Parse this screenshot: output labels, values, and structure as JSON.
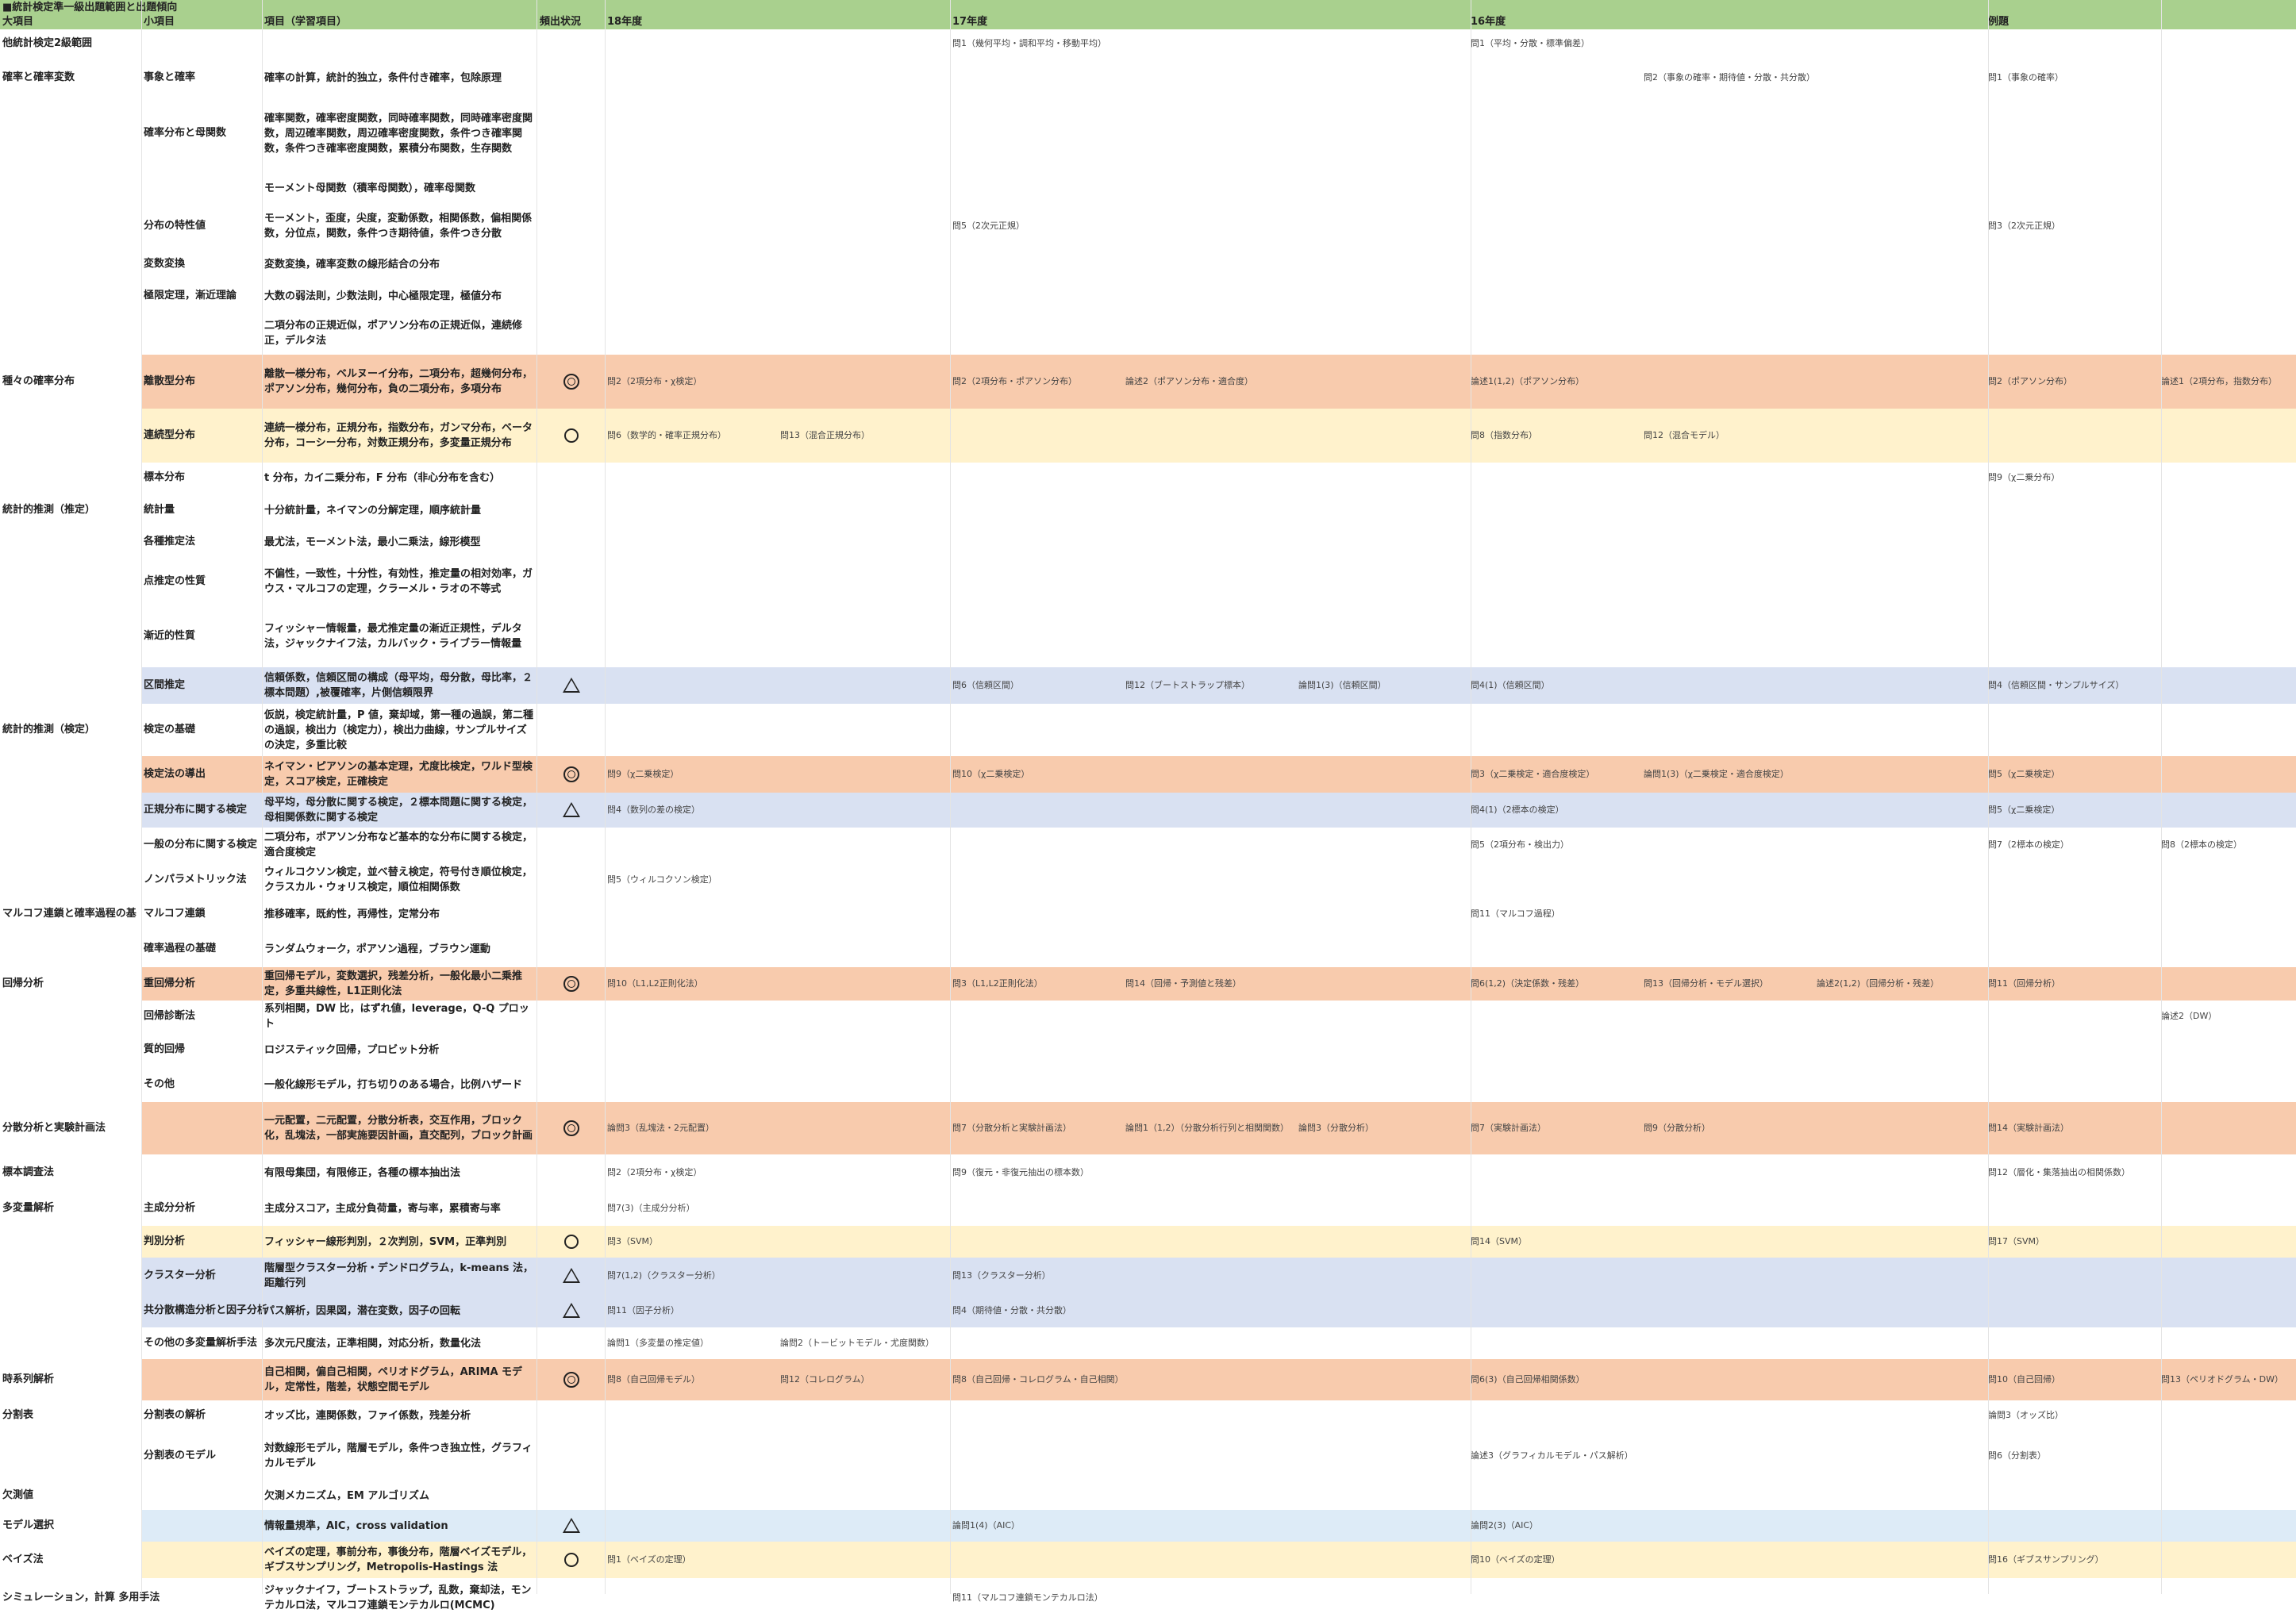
{
  "header": {
    "title": "■統計検定準一級出題範囲と出題傾向",
    "col_major": "大項目",
    "col_minor": "小項目",
    "col_item": "項目（学習項目）",
    "col_freq": "頻出状況",
    "col_y18": "18年度",
    "col_y17": "17年度",
    "col_y16": "16年度",
    "col_ex": "例題"
  },
  "colors": {
    "header": "#a9d08e",
    "orange": "#f8cbad",
    "yellow": "#fff2cc",
    "blue": "#d9e1f2",
    "lightblue": "#ddebf7"
  },
  "rows": [
    {
      "major": "他統計検定2級範囲",
      "minor": "",
      "item": "",
      "freq": "",
      "y18": [
        "",
        ""
      ],
      "y17": [
        "問1（幾何平均・調和平均・移動平均）",
        "",
        ""
      ],
      "y16": [
        "問1（平均・分散・標準偏差）",
        "",
        ""
      ],
      "ex": [
        "",
        ""
      ]
    },
    {
      "major": "確率と確率変数",
      "minor": "事象と確率",
      "item": "確率の計算，統計的独立，条件付き確率，包除原理",
      "freq": "",
      "y18": [
        "",
        ""
      ],
      "y17": [
        "",
        "",
        ""
      ],
      "y16": [
        "",
        "問2（事象の確率・期待値・分散・共分散）",
        ""
      ],
      "ex": [
        "問1（事象の確率）",
        ""
      ]
    },
    {
      "major": "",
      "minor": "確率分布と母関数",
      "item": "確率関数，確率密度関数，同時確率関数，同時確率密度関数，周辺確率関数，周辺確率密度関数，条件つき確率関数，条件つき確率密度関数，累積分布関数，生存関数",
      "freq": "",
      "y18": [
        "",
        ""
      ],
      "y17": [
        "",
        "",
        ""
      ],
      "y16": [
        "",
        "",
        ""
      ],
      "ex": [
        "",
        ""
      ]
    },
    {
      "major": "",
      "minor": "",
      "item": "モーメント母関数（積率母関数），確率母関数",
      "freq": "",
      "y18": [
        "",
        ""
      ],
      "y17": [
        "",
        "",
        ""
      ],
      "y16": [
        "",
        "",
        ""
      ],
      "ex": [
        "",
        ""
      ]
    },
    {
      "major": "",
      "minor": "分布の特性値",
      "item": "モーメント，歪度，尖度，変動係数，相関係数，偏相関係数，分位点，関数，条件つき期待値，条件つき分散",
      "freq": "",
      "y18": [
        "",
        ""
      ],
      "y17": [
        "問5（2次元正規）",
        "",
        ""
      ],
      "y16": [
        "",
        "",
        ""
      ],
      "ex": [
        "問3（2次元正規）",
        ""
      ]
    },
    {
      "major": "",
      "minor": "変数変換",
      "item": "変数変換，確率変数の線形結合の分布",
      "freq": "",
      "y18": [
        "",
        ""
      ],
      "y17": [
        "",
        "",
        ""
      ],
      "y16": [
        "",
        "",
        ""
      ],
      "ex": [
        "",
        ""
      ]
    },
    {
      "major": "",
      "minor": "極限定理，漸近理論",
      "item": "大数の弱法則，少数法則，中心極限定理，極値分布",
      "freq": "",
      "y18": [
        "",
        ""
      ],
      "y17": [
        "",
        "",
        ""
      ],
      "y16": [
        "",
        "",
        ""
      ],
      "ex": [
        "",
        ""
      ]
    },
    {
      "major": "",
      "minor": "",
      "item": "二項分布の正規近似，ポアソン分布の正規近似，連続修正，デルタ法",
      "freq": "",
      "y18": [
        "",
        ""
      ],
      "y17": [
        "",
        "",
        ""
      ],
      "y16": [
        "",
        "",
        ""
      ],
      "ex": [
        "",
        ""
      ]
    },
    {
      "major": "種々の確率分布",
      "minor": "離散型分布",
      "item": "離散一様分布，ベルヌーイ分布，二項分布，超幾何分布，ポアソン分布，幾何分布，負の二項分布，多項分布",
      "freq": "double",
      "y18": [
        "問2（2項分布・χ検定）",
        ""
      ],
      "y17": [
        "問2（2項分布・ポアソン分布）",
        "論述2（ポアソン分布・適合度）",
        ""
      ],
      "y16": [
        "論述1(1,2)（ポアソン分布）",
        "",
        ""
      ],
      "ex": [
        "問2（ポアソン分布）",
        "論述1（2項分布，指数分布）"
      ]
    },
    {
      "major": "",
      "minor": "連続型分布",
      "item": "連続一様分布，正規分布，指数分布，ガンマ分布，ベータ分布，コーシー分布，対数正規分布，多変量正規分布",
      "freq": "circle",
      "y18": [
        "問6（数学的・確率正規分布）",
        "問13（混合正規分布）"
      ],
      "y17": [
        "",
        "",
        ""
      ],
      "y16": [
        "問8（指数分布）",
        "問12（混合モデル）",
        ""
      ],
      "ex": [
        "",
        ""
      ]
    },
    {
      "major": "",
      "minor": "標本分布",
      "item": "t 分布，カイ二乗分布，F 分布（非心分布を含む）",
      "freq": "",
      "y18": [
        "",
        ""
      ],
      "y17": [
        "",
        "",
        ""
      ],
      "y16": [
        "",
        "",
        ""
      ],
      "ex": [
        "問9（χ二乗分布）",
        ""
      ]
    },
    {
      "major": "統計的推測（推定）",
      "minor": "統計量",
      "item": "十分統計量，ネイマンの分解定理，順序統計量",
      "freq": "",
      "y18": [
        "",
        ""
      ],
      "y17": [
        "",
        "",
        ""
      ],
      "y16": [
        "",
        "",
        ""
      ],
      "ex": [
        "",
        ""
      ]
    },
    {
      "major": "",
      "minor": "各種推定法",
      "item": "最尤法，モーメント法，最小二乗法，線形模型",
      "freq": "",
      "y18": [
        "",
        ""
      ],
      "y17": [
        "",
        "",
        ""
      ],
      "y16": [
        "",
        "",
        ""
      ],
      "ex": [
        "",
        ""
      ]
    },
    {
      "major": "",
      "minor": "点推定の性質",
      "item": "不偏性，一致性，十分性，有効性，推定量の相対効率，ガウス・マルコフの定理，クラーメル・ラオの不等式",
      "freq": "",
      "y18": [
        "",
        ""
      ],
      "y17": [
        "",
        "",
        ""
      ],
      "y16": [
        "",
        "",
        ""
      ],
      "ex": [
        "",
        ""
      ]
    },
    {
      "major": "",
      "minor": "漸近的性質",
      "item": "フィッシャー情報量，最尤推定量の漸近正規性，デルタ法，ジャックナイフ法，カルバック・ライブラー情報量",
      "freq": "",
      "y18": [
        "",
        ""
      ],
      "y17": [
        "",
        "",
        ""
      ],
      "y16": [
        "",
        "",
        ""
      ],
      "ex": [
        "",
        ""
      ]
    },
    {
      "major": "",
      "minor": "区間推定",
      "item": "信頼係数，信頼区間の構成（母平均，母分散，母比率，２標本問題）,被覆確率，片側信頼限界",
      "freq": "tri",
      "y18": [
        "",
        ""
      ],
      "y17": [
        "問6（信頼区間）",
        "問12（ブートストラップ標本）",
        "論問1(3)（信頼区間）"
      ],
      "y16": [
        "問4(1)（信頼区間）",
        "",
        ""
      ],
      "ex": [
        "問4（信頼区間・サンプルサイズ）",
        ""
      ]
    },
    {
      "major": "統計的推測（検定）",
      "minor": "検定の基礎",
      "item": "仮説，検定統計量，P 値，棄却域，第一種の過誤，第二種の過誤，検出力（検定力），検出力曲線，サンプルサイズの決定，多重比較",
      "freq": "",
      "y18": [
        "",
        ""
      ],
      "y17": [
        "",
        "",
        ""
      ],
      "y16": [
        "",
        "",
        ""
      ],
      "ex": [
        "",
        ""
      ]
    },
    {
      "major": "",
      "minor": "検定法の導出",
      "item": "ネイマン・ピアソンの基本定理，尤度比検定，ワルド型検定，スコア検定，正確検定",
      "freq": "double",
      "y18": [
        "問9（χ二乗検定）",
        ""
      ],
      "y17": [
        "問10（χ二乗検定）",
        "",
        ""
      ],
      "y16": [
        "問3（χ二乗検定・適合度検定）",
        "論問1(3)（χ二乗検定・適合度検定）",
        ""
      ],
      "ex": [
        "問5（χ二乗検定）",
        ""
      ]
    },
    {
      "major": "",
      "minor": "正規分布に関する検定",
      "item": "母平均，母分散に関する検定，２標本問題に関する検定，母相関係数に関する検定",
      "freq": "tri",
      "y18": [
        "問4（数列の差の検定）",
        ""
      ],
      "y17": [
        "",
        "",
        ""
      ],
      "y16": [
        "問4(1)（2標本の検定）",
        "",
        ""
      ],
      "ex": [
        "問5（χ二乗検定）",
        ""
      ]
    },
    {
      "major": "",
      "minor": "一般の分布に関する検定",
      "item": "二項分布，ポアソン分布など基本的な分布に関する検定，適合度検定",
      "freq": "",
      "y18": [
        "",
        ""
      ],
      "y17": [
        "",
        "",
        ""
      ],
      "y16": [
        "問5（2項分布・検出力）",
        "",
        ""
      ],
      "ex": [
        "問7（2標本の検定）",
        "問8（2標本の検定）"
      ]
    },
    {
      "major": "",
      "minor": "ノンパラメトリック法",
      "item": "ウィルコクソン検定，並べ替え検定，符号付き順位検定，クラスカル・ウォリス検定，順位相関係数",
      "freq": "",
      "y18": [
        "問5（ウィルコクソン検定）",
        ""
      ],
      "y17": [
        "",
        "",
        ""
      ],
      "y16": [
        "",
        "",
        ""
      ],
      "ex": [
        "",
        ""
      ]
    },
    {
      "major": "マルコフ連鎖と確率過程の基",
      "minor": "マルコフ連鎖",
      "item": "推移確率，既約性，再帰性，定常分布",
      "freq": "",
      "y18": [
        "",
        ""
      ],
      "y17": [
        "",
        "",
        ""
      ],
      "y16": [
        "問11（マルコフ過程）",
        "",
        ""
      ],
      "ex": [
        "",
        ""
      ]
    },
    {
      "major": "",
      "minor": "確率過程の基礎",
      "item": "ランダムウォーク，ポアソン過程，ブラウン運動",
      "freq": "",
      "y18": [
        "",
        ""
      ],
      "y17": [
        "",
        "",
        ""
      ],
      "y16": [
        "",
        "",
        ""
      ],
      "ex": [
        "",
        ""
      ]
    },
    {
      "major": "回帰分析",
      "minor": "重回帰分析",
      "item": "重回帰モデル，変数選択，残差分析，一般化最小二乗推定，多重共線性，L1正則化法",
      "freq": "double",
      "y18": [
        "問10（L1,L2正則化法）",
        ""
      ],
      "y17": [
        "問3（L1,L2正則化法）",
        "問14（回帰・予測値と残差）",
        ""
      ],
      "y16": [
        "問6(1,2)（決定係数・残差）",
        "問13（回帰分析・モデル選択）",
        "論述2(1,2)（回帰分析・残差）"
      ],
      "ex": [
        "問11（回帰分析）",
        ""
      ]
    },
    {
      "major": "",
      "minor": "回帰診断法",
      "item": "系列相関，DW 比，はずれ値，leverage，Q-Q プロット",
      "freq": "",
      "y18": [
        "",
        ""
      ],
      "y17": [
        "",
        "",
        ""
      ],
      "y16": [
        "",
        "",
        ""
      ],
      "ex": [
        "",
        "論述2（DW）"
      ]
    },
    {
      "major": "",
      "minor": "質的回帰",
      "item": "ロジスティック回帰，プロビット分析",
      "freq": "",
      "y18": [
        "",
        ""
      ],
      "y17": [
        "",
        "",
        ""
      ],
      "y16": [
        "",
        "",
        ""
      ],
      "ex": [
        "",
        ""
      ]
    },
    {
      "major": "",
      "minor": "その他",
      "item": "一般化線形モデル，打ち切りのある場合，比例ハザード",
      "freq": "",
      "y18": [
        "",
        ""
      ],
      "y17": [
        "",
        "",
        ""
      ],
      "y16": [
        "",
        "",
        ""
      ],
      "ex": [
        "",
        ""
      ]
    },
    {
      "major": "分散分析と実験計画法",
      "minor": "",
      "item": "一元配置，二元配置，分散分析表，交互作用，ブロック化，乱塊法，一部実施要因計画，直交配列，ブロック計画",
      "freq": "double",
      "y18": [
        "論問3（乱塊法・2元配置）",
        ""
      ],
      "y17": [
        "問7（分散分析と実験計画法）",
        "論問1（1,2）（分散分析行列と相関関数）",
        "論問3（分散分析）"
      ],
      "y16": [
        "問7（実験計画法）",
        "問9（分散分析）",
        ""
      ],
      "ex": [
        "問14（実験計画法）",
        ""
      ]
    },
    {
      "major": "標本調査法",
      "minor": "",
      "item": "有限母集団，有限修正，各種の標本抽出法",
      "freq": "",
      "y18": [
        "問2（2項分布・χ検定）",
        ""
      ],
      "y17": [
        "問9（復元・非復元抽出の標本数）",
        "",
        ""
      ],
      "y16": [
        "",
        "",
        ""
      ],
      "ex": [
        "問12（層化・集落抽出の相関係数）",
        ""
      ]
    },
    {
      "major": "多変量解析",
      "minor": "主成分分析",
      "item": "主成分スコア，主成分負荷量，寄与率，累積寄与率",
      "freq": "",
      "y18": [
        "問7(3)（主成分分析）",
        ""
      ],
      "y17": [
        "",
        "",
        ""
      ],
      "y16": [
        "",
        "",
        ""
      ],
      "ex": [
        "",
        ""
      ]
    },
    {
      "major": "",
      "minor": "判別分析",
      "item": "フィッシャー線形判別，２次判別，SVM，正準判別",
      "freq": "circle",
      "y18": [
        "問3（SVM）",
        ""
      ],
      "y17": [
        "",
        "",
        ""
      ],
      "y16": [
        "問14（SVM）",
        "",
        ""
      ],
      "ex": [
        "問17（SVM）",
        ""
      ]
    },
    {
      "major": "",
      "minor": "クラスター分析",
      "item": "階層型クラスター分析・デンドログラム，k-means 法，距離行列",
      "freq": "tri",
      "y18": [
        "問7(1,2)（クラスター分析）",
        ""
      ],
      "y17": [
        "問13（クラスター分析）",
        "",
        ""
      ],
      "y16": [
        "",
        "",
        ""
      ],
      "ex": [
        "",
        ""
      ]
    },
    {
      "major": "",
      "minor": "共分散構造分析と因子分析",
      "item": "パス解析，因果図，潜在変数，因子の回転",
      "freq": "tri",
      "y18": [
        "問11（因子分析）",
        ""
      ],
      "y17": [
        "問4（期待値・分散・共分散）",
        "",
        ""
      ],
      "y16": [
        "",
        "",
        ""
      ],
      "ex": [
        "",
        ""
      ]
    },
    {
      "major": "",
      "minor": "その他の多変量解析手法",
      "item": "多次元尺度法，正準相関，対応分析，数量化法",
      "freq": "",
      "y18": [
        "論問1（多変量の推定値）",
        "論問2（トービットモデル・尤度関数）"
      ],
      "y17": [
        "",
        "",
        ""
      ],
      "y16": [
        "",
        "",
        ""
      ],
      "ex": [
        "",
        ""
      ]
    },
    {
      "major": "時系列解析",
      "minor": "",
      "item": "自己相関，偏自己相関，ペリオドグラム，ARIMA モデル，定常性，階差，状態空間モデル",
      "freq": "double",
      "y18": [
        "問8（自己回帰モデル）",
        "問12（コレログラム）"
      ],
      "y17": [
        "問8（自己回帰・コレログラム・自己相関）",
        "",
        ""
      ],
      "y16": [
        "問6(3)（自己回帰相関係数）",
        "",
        ""
      ],
      "ex": [
        "問10（自己回帰）",
        "問13（ペリオドグラム・DW）"
      ]
    },
    {
      "major": "分割表",
      "minor": "分割表の解析",
      "item": "オッズ比，連関係数，ファイ係数，残差分析",
      "freq": "",
      "y18": [
        "",
        ""
      ],
      "y17": [
        "",
        "",
        ""
      ],
      "y16": [
        "",
        "",
        ""
      ],
      "ex": [
        "論問3（オッズ比）",
        ""
      ]
    },
    {
      "major": "",
      "minor": "分割表のモデル",
      "item": "対数線形モデル，階層モデル，条件つき独立性，グラフィカルモデル",
      "freq": "",
      "y18": [
        "",
        ""
      ],
      "y17": [
        "",
        "",
        ""
      ],
      "y16": [
        "論述3（グラフィカルモデル・パス解析）",
        "",
        ""
      ],
      "ex": [
        "問6（分割表）",
        ""
      ]
    },
    {
      "major": "欠測値",
      "minor": "",
      "item": "欠測メカニズム，EM アルゴリズム",
      "freq": "",
      "y18": [
        "",
        ""
      ],
      "y17": [
        "",
        "",
        ""
      ],
      "y16": [
        "",
        "",
        ""
      ],
      "ex": [
        "",
        ""
      ]
    },
    {
      "major": "モデル選択",
      "minor": "",
      "item": "情報量規準，AIC，cross validation",
      "freq": "tri",
      "y18": [
        "",
        ""
      ],
      "y17": [
        "論問1(4)（AIC）",
        "",
        ""
      ],
      "y16": [
        "論問2(3)（AIC）",
        "",
        ""
      ],
      "ex": [
        "",
        ""
      ]
    },
    {
      "major": "ベイズ法",
      "minor": "",
      "item": "ベイズの定理，事前分布，事後分布，階層ベイズモデル，ギブスサンプリング，Metropolis-Hastings 法",
      "freq": "circle",
      "y18": [
        "問1（ベイズの定理）",
        ""
      ],
      "y17": [
        "",
        "",
        ""
      ],
      "y16": [
        "問10（ベイズの定理）",
        "",
        ""
      ],
      "ex": [
        "問16（ギブスサンプリング）",
        ""
      ]
    },
    {
      "major": "シミュレーション，計算 多用手法",
      "minor": "",
      "item": "ジャックナイフ，ブートストラップ，乱数，棄却法，モンテカルロ法，マルコフ連鎖モンテカルロ(MCMC)",
      "freq": "",
      "y18": [
        "",
        ""
      ],
      "y17": [
        "問11（マルコフ連鎖モンテカルロ法）",
        "",
        ""
      ],
      "y16": [
        "",
        "",
        ""
      ],
      "ex": [
        "",
        ""
      ]
    }
  ]
}
